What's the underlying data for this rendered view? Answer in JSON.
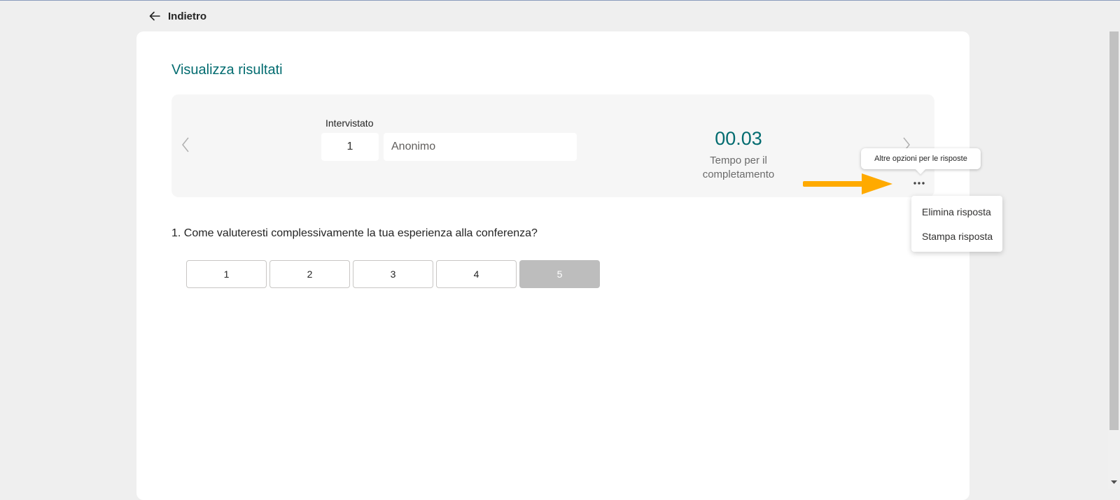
{
  "header": {
    "back_label": "Indietro"
  },
  "page": {
    "title": "Visualizza risultati"
  },
  "summary": {
    "respondent_label": "Intervistato",
    "respondent_number": "1",
    "respondent_name": "Anonimo",
    "completion_time": "00.03",
    "completion_label": "Tempo per il completamento"
  },
  "more_options": {
    "tooltip": "Altre opzioni per le risposte",
    "menu": [
      "Elimina risposta",
      "Stampa risposta"
    ]
  },
  "question": {
    "text": "1. Come valuteresti complessivamente la tua esperienza alla conferenza?",
    "options": [
      "1",
      "2",
      "3",
      "4",
      "5"
    ],
    "selected": "5"
  },
  "colors": {
    "accent": "#036c70",
    "arrow": "#ffaa00",
    "selected_option": "#bdbdbd"
  },
  "icons": [
    "back-arrow-icon",
    "chevron-left-icon",
    "chevron-right-icon",
    "more-options-icon",
    "pointer-arrow-icon"
  ]
}
